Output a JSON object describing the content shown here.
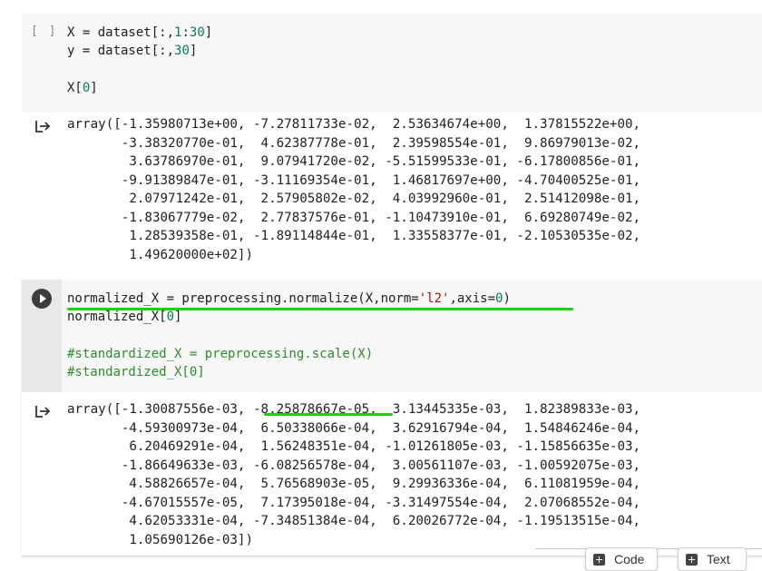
{
  "cells": [
    {
      "status": "[ ]",
      "code_lines": [
        [
          "X = dataset[:,",
          "1",
          ":",
          "30",
          "]"
        ],
        [
          "y = dataset[:,",
          "30",
          "]"
        ],
        [
          ""
        ],
        [
          "X[",
          "0",
          "]"
        ]
      ],
      "output": "array([-1.35980713e+00, -7.27811733e-02,  2.53634674e+00,  1.37815522e+00,\n       -3.38320770e-01,  4.62387778e-01,  2.39598554e-01,  9.86979013e-02,\n        3.63786970e-01,  9.07941720e-02, -5.51599533e-01, -6.17800856e-01,\n       -9.91389847e-01, -3.11169354e-01,  1.46817697e+00, -4.70400525e-01,\n        2.07971242e-01,  2.57905802e-02,  4.03992960e-01,  2.51412098e-01,\n       -1.83067779e-02,  2.77837576e-01, -1.10473910e-01,  6.69280749e-02,\n        1.28539358e-01, -1.89114844e-01,  1.33558377e-01, -2.10530535e-02,\n        1.49620000e+02])"
    },
    {
      "code": {
        "l1a": "normalized_X = preprocessing.normalize(X,norm=",
        "l1b": "'l2'",
        "l1c": ",axis=",
        "l1d": "0",
        "l1e": ")",
        "l2a": "normalized_X[",
        "l2b": "0",
        "l2c": "]",
        "l4": "#standardized_X = preprocessing.scale(X)",
        "l5": "#standardized_X[0]"
      },
      "output": "array([-1.30087556e-03, -8.25878667e-05,  3.13445335e-03,  1.82389833e-03,\n       -4.59300973e-04,  6.50338066e-04,  3.62916794e-04,  1.54846246e-04,\n        6.20469291e-04,  1.56248351e-04, -1.01261805e-03, -1.15856635e-03,\n       -1.86649633e-03, -6.08256578e-04,  3.00561107e-03, -1.00592075e-03,\n        4.58826657e-04,  5.76568903e-05,  9.29936336e-04,  6.11081959e-04,\n       -4.67015557e-05,  7.17395018e-04, -3.31497554e-04,  2.07068552e-04,\n        4.62053331e-04, -7.34851384e-04,  6.20026772e-04, -1.19513515e-04,\n        1.05690126e-03])"
    }
  ],
  "toolbar": {
    "add_code_label": "Code",
    "add_text_label": "Text"
  },
  "icons": {
    "run": "play-circle-icon",
    "output": "output-arrow-icon",
    "add": "plus-box-icon"
  },
  "colors": {
    "annotation": "#22cc11",
    "number": "#0a7c55",
    "string": "#a31515",
    "comment": "#2e8b2e"
  }
}
